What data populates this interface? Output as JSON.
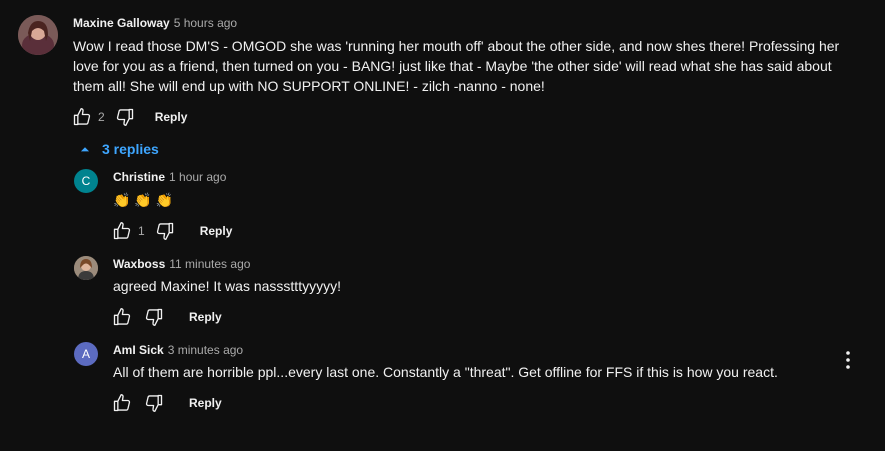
{
  "main_comment": {
    "author": "Maxine Galloway",
    "time": "5 hours ago",
    "text_lines": [
      "Wow I read those DM'S - OMGOD she was 'running her mouth off' about the other side, and now shes there! Professing her",
      "love for you as a friend, then turned on you - BANG! just like that - Maybe 'the other side' will read what she has said about",
      "them all! She will end up with NO SUPPORT ONLINE! - zilch -nanno - none!"
    ],
    "like_count": "2",
    "reply_label": "Reply",
    "replies_toggle": "3 replies"
  },
  "replies": [
    {
      "author": "Christine",
      "time": "1 hour ago",
      "avatar_letter": "C",
      "avatar_color": "#00838f",
      "text": "👏 👏 👏",
      "like_count": "1",
      "reply_label": "Reply"
    },
    {
      "author": "Waxboss",
      "time": "11 minutes ago",
      "text": "agreed Maxine! It was nassstttyyyyy!",
      "reply_label": "Reply"
    },
    {
      "author": "AmI Sick",
      "time": "3 minutes ago",
      "avatar_letter": "A",
      "avatar_color": "#5c6bc0",
      "text": "All of them are horrible ppl...every last one. Constantly a \"threat\". Get offline for FFS if this is how you react.",
      "reply_label": "Reply"
    }
  ],
  "colors": {
    "background": "#0f0f0f",
    "link_blue": "#3ea6ff",
    "muted_text": "#aaaaaa"
  }
}
